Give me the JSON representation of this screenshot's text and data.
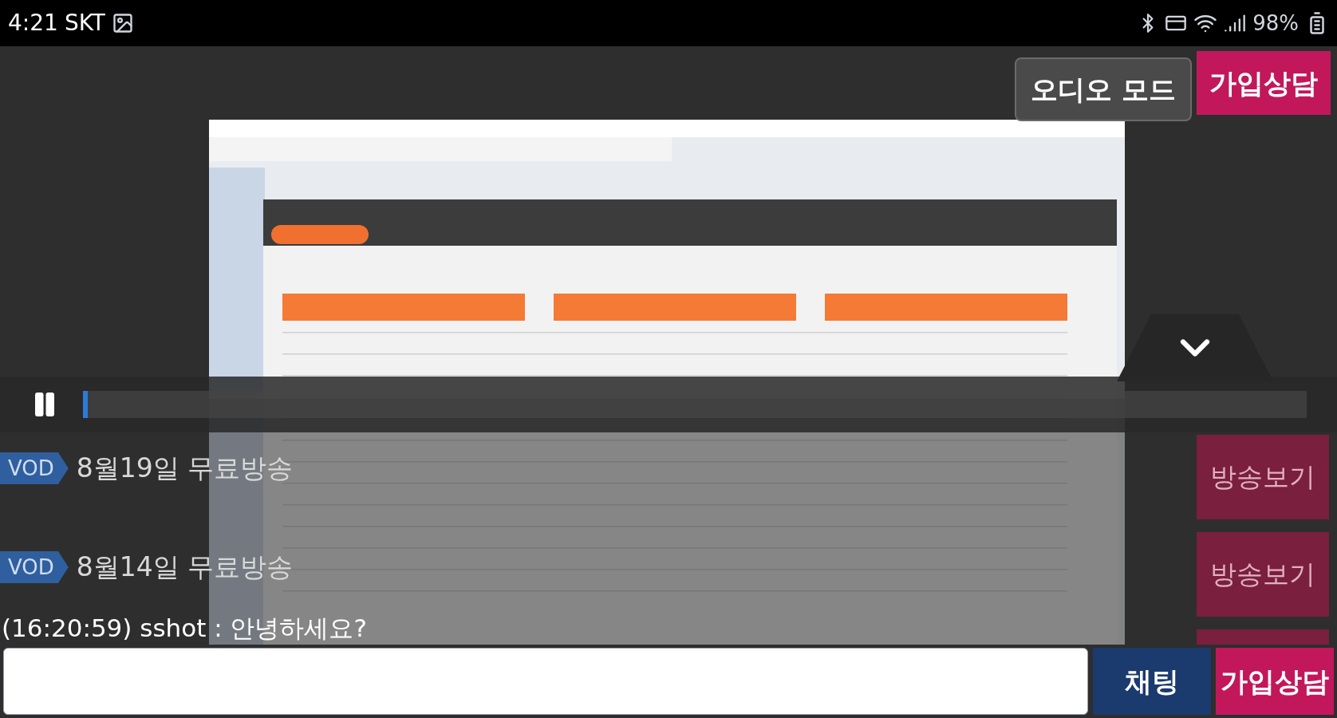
{
  "status_bar": {
    "time": "4:21",
    "carrier": "SKT",
    "battery": "98%"
  },
  "header_buttons": [
    {
      "label": "오디오 모드",
      "kind": "audio"
    },
    {
      "label": "가입상담",
      "kind": "signup"
    }
  ],
  "player": {
    "kind": "picture",
    "playing": true,
    "progress": {
      "level": 0
    }
  },
  "vod_list": [
    {
      "tag": "VOD",
      "title": "8월19일 무료방송",
      "action": "방송보기"
    },
    {
      "tag": "VOD",
      "title": "8월14일 무료방송",
      "action": "방송보기"
    }
  ],
  "chat_messages": [
    "(16:20:59) sshot : 안녕하세요?"
  ],
  "bottom_buttons": [
    {
      "label": "채팅",
      "kind": "chat"
    },
    {
      "label": "가입상담",
      "kind": "signup"
    }
  ]
}
